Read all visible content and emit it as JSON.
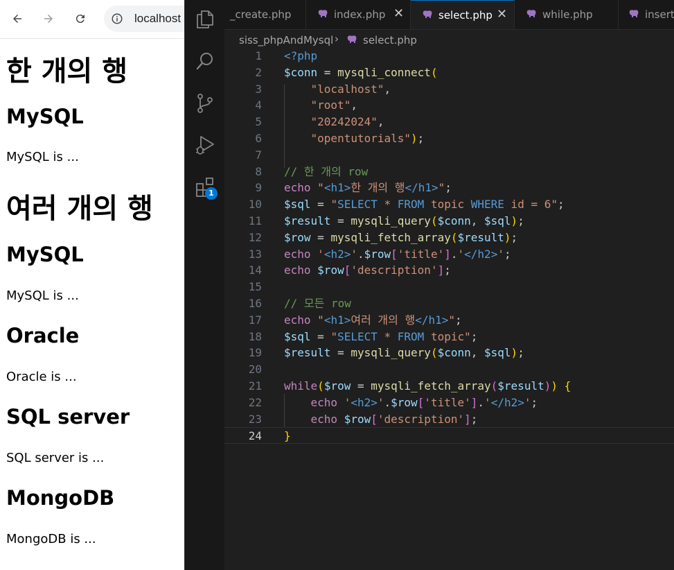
{
  "browser": {
    "url": "localhost",
    "content": {
      "h1_single": "한 개의 행",
      "h1_multi": "여러 개의 행",
      "rows": [
        {
          "title": "MySQL",
          "description": "MySQL is ..."
        },
        {
          "title": "MySQL",
          "description": "MySQL is ..."
        },
        {
          "title": "Oracle",
          "description": "Oracle is ..."
        },
        {
          "title": "SQL server",
          "description": "SQL server is ..."
        },
        {
          "title": "MongoDB",
          "description": "MongoDB is ..."
        }
      ]
    }
  },
  "vscode": {
    "extensions_badge": "1",
    "tabs": [
      {
        "label": "_create.php",
        "active": false
      },
      {
        "label": "index.php",
        "active": false,
        "close": "✕"
      },
      {
        "label": "select.php",
        "active": true,
        "close": "✕"
      },
      {
        "label": "while.php",
        "active": false
      },
      {
        "label": "insert",
        "active": false
      }
    ],
    "breadcrumb": {
      "folder": "siss_phpAndMysql",
      "file": "select.php"
    },
    "current_line": 24,
    "lines": [
      {
        "n": "1",
        "t": [
          [
            "k",
            "<?php"
          ]
        ]
      },
      {
        "n": "2",
        "t": [
          [
            "v",
            "$conn"
          ],
          [
            "p",
            " = "
          ],
          [
            "f",
            "mysqli_connect"
          ],
          [
            "b1",
            "("
          ]
        ]
      },
      {
        "n": "3",
        "t": [
          [
            "p",
            "    "
          ],
          [
            "s",
            "\"localhost\""
          ],
          [
            "p",
            ","
          ]
        ]
      },
      {
        "n": "4",
        "t": [
          [
            "p",
            "    "
          ],
          [
            "s",
            "\"root\""
          ],
          [
            "p",
            ","
          ]
        ]
      },
      {
        "n": "5",
        "t": [
          [
            "p",
            "    "
          ],
          [
            "s",
            "\"20242024\""
          ],
          [
            "p",
            ","
          ]
        ]
      },
      {
        "n": "6",
        "t": [
          [
            "p",
            "    "
          ],
          [
            "s",
            "\"opentutorials\""
          ],
          [
            "b1",
            ")"
          ],
          [
            "p",
            ";"
          ]
        ]
      },
      {
        "n": "7",
        "t": []
      },
      {
        "n": "8",
        "t": [
          [
            "cm",
            "// 한 개의 row"
          ]
        ]
      },
      {
        "n": "9",
        "t": [
          [
            "c",
            "echo"
          ],
          [
            "p",
            " "
          ],
          [
            "s",
            "\""
          ],
          [
            "k",
            "<h1>"
          ],
          [
            "s",
            "한 개의 행"
          ],
          [
            "k",
            "</h1>"
          ],
          [
            "s",
            "\""
          ],
          [
            "p",
            ";"
          ]
        ]
      },
      {
        "n": "10",
        "t": [
          [
            "v",
            "$sql"
          ],
          [
            "p",
            " = "
          ],
          [
            "s",
            "\""
          ],
          [
            "k",
            "SELECT"
          ],
          [
            "s",
            " * "
          ],
          [
            "k",
            "FROM"
          ],
          [
            "s",
            " topic "
          ],
          [
            "k",
            "WHERE"
          ],
          [
            "s",
            " id = 6\""
          ],
          [
            "p",
            ";"
          ]
        ]
      },
      {
        "n": "11",
        "t": [
          [
            "v",
            "$result"
          ],
          [
            "p",
            " = "
          ],
          [
            "f",
            "mysqli_query"
          ],
          [
            "b1",
            "("
          ],
          [
            "v",
            "$conn"
          ],
          [
            "p",
            ", "
          ],
          [
            "v",
            "$sql"
          ],
          [
            "b1",
            ")"
          ],
          [
            "p",
            ";"
          ]
        ]
      },
      {
        "n": "12",
        "t": [
          [
            "v",
            "$row"
          ],
          [
            "p",
            " = "
          ],
          [
            "f",
            "mysqli_fetch_array"
          ],
          [
            "b1",
            "("
          ],
          [
            "v",
            "$result"
          ],
          [
            "b1",
            ")"
          ],
          [
            "p",
            ";"
          ]
        ]
      },
      {
        "n": "13",
        "t": [
          [
            "c",
            "echo"
          ],
          [
            "p",
            " "
          ],
          [
            "s",
            "'"
          ],
          [
            "k",
            "<h2>"
          ],
          [
            "s",
            "'"
          ],
          [
            "p",
            "."
          ],
          [
            "v",
            "$row"
          ],
          [
            "b2",
            "["
          ],
          [
            "s",
            "'title'"
          ],
          [
            "b2",
            "]"
          ],
          [
            "p",
            "."
          ],
          [
            "s",
            "'"
          ],
          [
            "k",
            "</h2>"
          ],
          [
            "s",
            "'"
          ],
          [
            "p",
            ";"
          ]
        ]
      },
      {
        "n": "14",
        "t": [
          [
            "c",
            "echo"
          ],
          [
            "p",
            " "
          ],
          [
            "v",
            "$row"
          ],
          [
            "b2",
            "["
          ],
          [
            "s",
            "'description'"
          ],
          [
            "b2",
            "]"
          ],
          [
            "p",
            ";"
          ]
        ]
      },
      {
        "n": "15",
        "t": []
      },
      {
        "n": "16",
        "t": [
          [
            "cm",
            "// 모든 row"
          ]
        ]
      },
      {
        "n": "17",
        "t": [
          [
            "c",
            "echo"
          ],
          [
            "p",
            " "
          ],
          [
            "s",
            "\""
          ],
          [
            "k",
            "<h1>"
          ],
          [
            "s",
            "여러 개의 행"
          ],
          [
            "k",
            "</h1>"
          ],
          [
            "s",
            "\""
          ],
          [
            "p",
            ";"
          ]
        ]
      },
      {
        "n": "18",
        "t": [
          [
            "v",
            "$sql"
          ],
          [
            "p",
            " = "
          ],
          [
            "s",
            "\""
          ],
          [
            "k",
            "SELECT"
          ],
          [
            "s",
            " * "
          ],
          [
            "k",
            "FROM"
          ],
          [
            "s",
            " topic\""
          ],
          [
            "p",
            ";"
          ]
        ]
      },
      {
        "n": "19",
        "t": [
          [
            "v",
            "$result"
          ],
          [
            "p",
            " = "
          ],
          [
            "f",
            "mysqli_query"
          ],
          [
            "b1",
            "("
          ],
          [
            "v",
            "$conn"
          ],
          [
            "p",
            ", "
          ],
          [
            "v",
            "$sql"
          ],
          [
            "b1",
            ")"
          ],
          [
            "p",
            ";"
          ]
        ]
      },
      {
        "n": "20",
        "t": []
      },
      {
        "n": "21",
        "t": [
          [
            "c",
            "while"
          ],
          [
            "b1",
            "("
          ],
          [
            "v",
            "$row"
          ],
          [
            "p",
            " = "
          ],
          [
            "f",
            "mysqli_fetch_array"
          ],
          [
            "b2",
            "("
          ],
          [
            "v",
            "$result"
          ],
          [
            "b2",
            ")"
          ],
          [
            "b1",
            ")"
          ],
          [
            "p",
            " "
          ],
          [
            "b1",
            "{"
          ]
        ]
      },
      {
        "n": "22",
        "t": [
          [
            "p",
            "    "
          ],
          [
            "c",
            "echo"
          ],
          [
            "p",
            " "
          ],
          [
            "s",
            "'"
          ],
          [
            "k",
            "<h2>"
          ],
          [
            "s",
            "'"
          ],
          [
            "p",
            "."
          ],
          [
            "v",
            "$row"
          ],
          [
            "b2",
            "["
          ],
          [
            "s",
            "'title'"
          ],
          [
            "b2",
            "]"
          ],
          [
            "p",
            "."
          ],
          [
            "s",
            "'"
          ],
          [
            "k",
            "</h2>"
          ],
          [
            "s",
            "'"
          ],
          [
            "p",
            ";"
          ]
        ]
      },
      {
        "n": "23",
        "t": [
          [
            "p",
            "    "
          ],
          [
            "c",
            "echo"
          ],
          [
            "p",
            " "
          ],
          [
            "v",
            "$row"
          ],
          [
            "b2",
            "["
          ],
          [
            "s",
            "'description'"
          ],
          [
            "b2",
            "]"
          ],
          [
            "p",
            ";"
          ]
        ]
      },
      {
        "n": "24",
        "t": [
          [
            "b1",
            "}"
          ]
        ]
      }
    ]
  }
}
